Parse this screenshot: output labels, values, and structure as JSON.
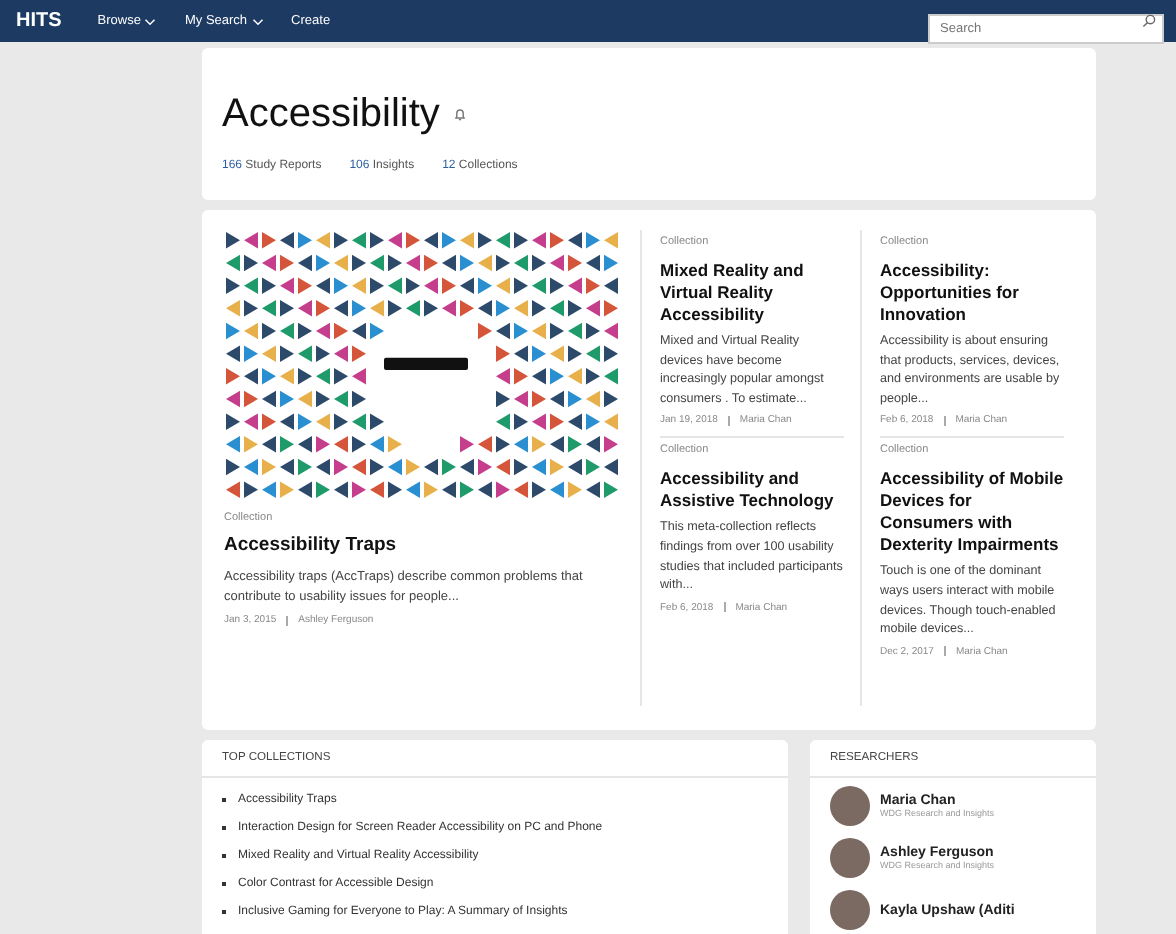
{
  "nav": {
    "logo": "HITS",
    "menu": [
      {
        "label": "Browse",
        "dropdown": true
      },
      {
        "label": "My Search",
        "dropdown": true
      },
      {
        "label": "Create",
        "dropdown": false
      }
    ],
    "search": {
      "placeholder": "Search"
    }
  },
  "header": {
    "title": "Accessibility",
    "stats": [
      {
        "count": "166",
        "label": "Study Reports"
      },
      {
        "count": "106",
        "label": "Insights"
      },
      {
        "count": "12",
        "label": "Collections"
      }
    ]
  },
  "featured": {
    "type": "Collection",
    "title": "Accessibility Traps",
    "summary": "Accessibility traps (AccTraps) describe common problems that contribute to usability issues for people...",
    "date": "Jan 3, 2015",
    "author": "Ashley Ferguson"
  },
  "cards": [
    {
      "type": "Collection",
      "title": "Mixed Reality and Virtual Reality Accessibility",
      "summary": "Mixed and Virtual Reality devices have become increasingly popular amongst consumers . To estimate...",
      "date": "Jan 19, 2018",
      "author": "Maria Chan"
    },
    {
      "type": "Collection",
      "title": "Accessibility and Assistive Technology",
      "summary": "This meta-collection reflects findings from over 100 usability studies that included participants with...",
      "date": "Feb 6, 2018",
      "author": "Maria Chan"
    },
    {
      "type": "Collection",
      "title": "Accessibility: Opportunities for Innovation",
      "summary": "Accessibility is about ensuring that products, services, devices, and environments are usable by people...",
      "date": "Feb 6, 2018",
      "author": "Maria Chan"
    },
    {
      "type": "Collection",
      "title": "Accessibility of Mobile Devices for Consumers with Dexterity Impairments",
      "summary": "Touch is one of the dominant ways users interact with mobile devices. Though touch-enabled mobile devices...",
      "date": "Dec 2, 2017",
      "author": "Maria Chan"
    }
  ],
  "top_collections": {
    "heading": "TOP COLLECTIONS",
    "items": [
      "Accessibility Traps",
      "Interaction Design for Screen Reader Accessibility on PC and Phone",
      "Mixed Reality and Virtual Reality Accessibility",
      "Color Contrast for Accessible Design",
      "Inclusive Gaming for Everyone to Play: A Summary of Insights"
    ]
  },
  "researchers": {
    "heading": "RESEARCHERS",
    "people": [
      {
        "name": "Maria Chan",
        "team": "WDG Research and Insights"
      },
      {
        "name": "Ashley Ferguson",
        "team": "WDG Research and Insights"
      },
      {
        "name": "Kayla Upshaw (Aditi"
      }
    ]
  }
}
